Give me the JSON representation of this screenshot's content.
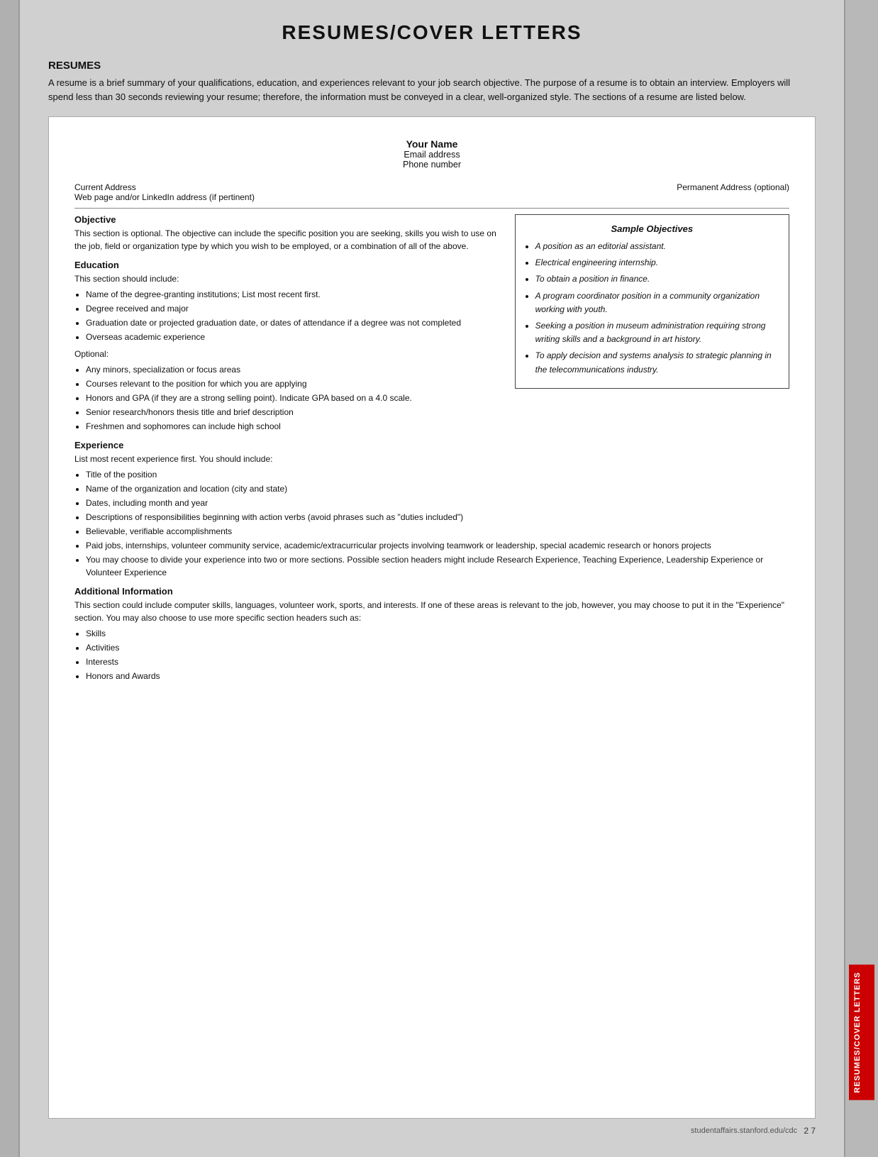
{
  "page": {
    "title": "RESUMES/COVER LETTERS",
    "footer_url": "studentaffairs.stanford.edu/cdc",
    "page_number": "2 7"
  },
  "resumes_section": {
    "heading": "RESUMES",
    "intro": "A resume is a brief summary of your qualifications, education, and experiences relevant to your job search objective. The purpose of a resume is to obtain an interview. Employers will spend less than 30 seconds reviewing your resume; therefore, the information must be conveyed in a clear, well-organized style. The sections of a resume are listed below."
  },
  "document": {
    "header": {
      "name": "Your Name",
      "email": "Email address",
      "phone": "Phone number"
    },
    "address_left": "Current Address",
    "address_left2": "Web page and/or LinkedIn address (if pertinent)",
    "address_right": "Permanent Address (optional)",
    "objective_title": "Objective",
    "objective_text": "This section is optional. The objective can include the specific position you are seeking, skills you wish to use on the job, field or organization type by which you wish to be employed, or a combination of all of the above.",
    "sample_objectives": {
      "title": "Sample Objectives",
      "items": [
        "A position as an editorial assistant.",
        "Electrical engineering internship.",
        "To obtain a position in finance.",
        "A program coordinator position in a community organization working with youth.",
        "Seeking a position in museum administration requiring strong writing skills and a background in art history.",
        "To apply decision and systems analysis to strategic planning in the telecommunications industry."
      ]
    },
    "education_title": "Education",
    "education_intro": "This section should include:",
    "education_bullets": [
      "Name of the degree-granting institutions; List most recent first.",
      "Degree received and major",
      "Graduation date or projected graduation date, or dates of attendance if a degree was not completed",
      "Overseas academic experience"
    ],
    "education_optional_label": "Optional:",
    "education_optional_bullets": [
      "Any minors, specialization or focus areas",
      "Courses relevant to the position for which you are applying",
      "Honors and GPA (if they are a strong selling point). Indicate GPA based on a 4.0 scale.",
      "Senior research/honors thesis title and brief description",
      "Freshmen and sophomores can include high school"
    ],
    "experience_title": "Experience",
    "experience_intro": "List most recent experience first. You should include:",
    "experience_bullets": [
      "Title of the position",
      "Name of the organization and location (city and state)",
      "Dates, including month and year",
      "Descriptions of responsibilities beginning with action verbs (avoid phrases such as \"duties included\")",
      "Believable, verifiable accomplishments",
      "Paid jobs, internships, volunteer community service, academic/extracurricular projects involving teamwork or leadership, special academic research or honors projects",
      "You may choose to divide your experience into two or more sections. Possible section headers might include Research Experience, Teaching Experience, Leadership Experience or Volunteer Experience"
    ],
    "additional_title": "Additional Information",
    "additional_text": "This section could include computer skills, languages, volunteer work, sports, and interests. If one of these areas is relevant to the job, however, you may choose to put it in the \"Experience\" section. You may also choose to use more specific section headers such as:",
    "additional_bullets": [
      "Skills",
      "Activities",
      "Interests",
      "Honors and Awards"
    ]
  },
  "right_tab_label": "RESUMES/COVER LETTERS"
}
